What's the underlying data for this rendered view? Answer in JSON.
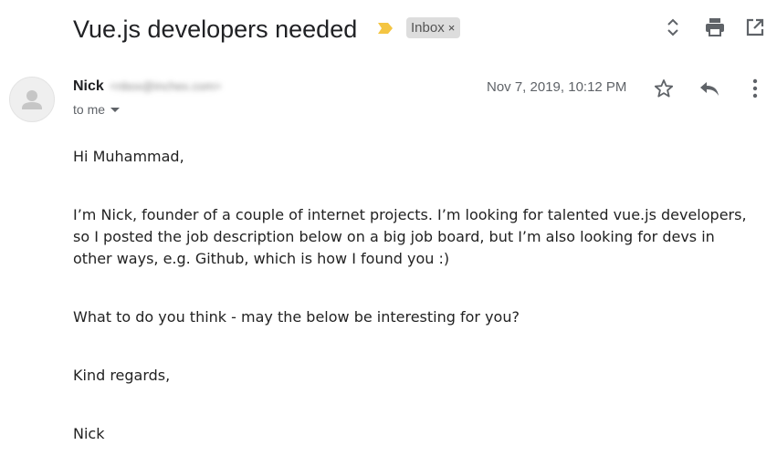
{
  "email": {
    "subject": "Vue.js developers needed",
    "label": "Inbox",
    "label_remove": "×",
    "sender_name": "Nick",
    "sender_email": "<nbox@inchex.com>",
    "recipient": "to me",
    "date": "Nov 7, 2019, 10:12 PM",
    "greeting": "Hi Muhammad,",
    "paragraph1_line1": "I’m Nick, founder of a couple of internet projects. I’m looking for talented vue.js developers,",
    "paragraph1_line2": "so I posted the job description below on a big job board, but I’m also looking for devs in",
    "paragraph1_line3": "other ways, e.g. Github, which is how I found you :)",
    "paragraph2": "What to do you think - may the below be interesting for you?",
    "closing": "Kind regards,",
    "signature": "Nick"
  },
  "icons": {
    "importance": "importance-marker-icon",
    "expand": "expand-collapse-icon",
    "print": "print-icon",
    "new_window": "open-in-new-window-icon",
    "star": "star-icon",
    "reply": "reply-icon",
    "more": "more-options-icon",
    "avatar": "avatar-icon"
  },
  "colors": {
    "importance": "#f4c542",
    "icon": "#5f6368",
    "label_bg": "#dddddd"
  }
}
